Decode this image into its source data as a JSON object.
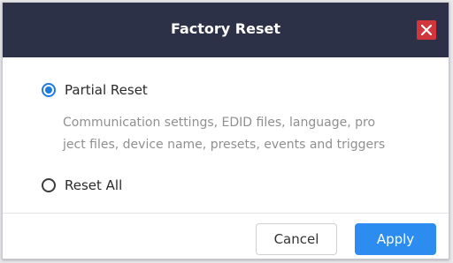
{
  "dialog": {
    "title": "Factory Reset",
    "close_icon": "close-icon",
    "options": [
      {
        "label": "Partial Reset",
        "selected": true,
        "description_lines": [
          "Communication settings, EDID files, language, pro",
          "ject files, device name, presets, events and triggers"
        ]
      },
      {
        "label": "Reset All",
        "selected": false
      }
    ],
    "buttons": {
      "cancel_label": "Cancel",
      "apply_label": "Apply"
    },
    "colors": {
      "titlebar": "#2d3147",
      "close_button": "#d1363d",
      "accent": "#2d8cf0"
    }
  }
}
